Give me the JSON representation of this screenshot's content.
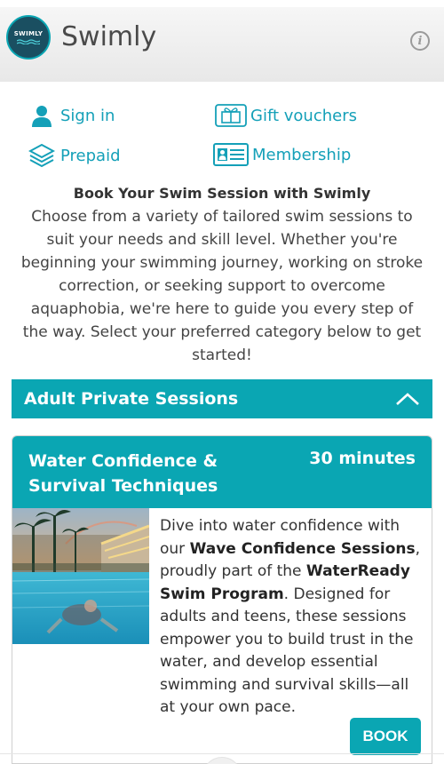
{
  "header": {
    "logo_text": "SWIMLY",
    "logo_subtext": "SWIMMING SCHOOL & EXPERIENCES",
    "title": "Swimly",
    "info_icon": "info-icon"
  },
  "links": [
    {
      "label": "Sign in",
      "icon": "user-icon"
    },
    {
      "label": "Gift vouchers",
      "icon": "gift-voucher-icon"
    },
    {
      "label": "Prepaid",
      "icon": "layers-icon"
    },
    {
      "label": "Membership",
      "icon": "membership-card-icon"
    }
  ],
  "intro": {
    "heading": "Book Your Swim Session with Swimly",
    "body": "Choose from a variety of tailored swim sessions to suit your needs and skill level. Whether you're beginning your swimming journey, working on stroke correction, or seeking support to overcome aquaphobia, we're here to guide you every step of the way. Select your preferred category below to get started!"
  },
  "category": {
    "title": "Adult Private Sessions",
    "toggle_icon": "chevron-up-icon"
  },
  "session": {
    "title": "Water Confidence & Survival Techniques",
    "duration": "30 minutes",
    "desc_1": "Dive into water confidence with our ",
    "desc_b1": "Wave Confidence Sessions",
    "desc_2": ", proudly part of the ",
    "desc_b2": "WaterReady Swim Program",
    "desc_3": ". Designed for adults and teens, these sessions empower you to build trust in the water, and develop essential swimming and survival skills—all at your own pace.",
    "book_label": "BOOK"
  },
  "colors": {
    "accent": "#0aa6b3",
    "link": "#14a0b8",
    "logo_bg": "#1a4f61"
  }
}
